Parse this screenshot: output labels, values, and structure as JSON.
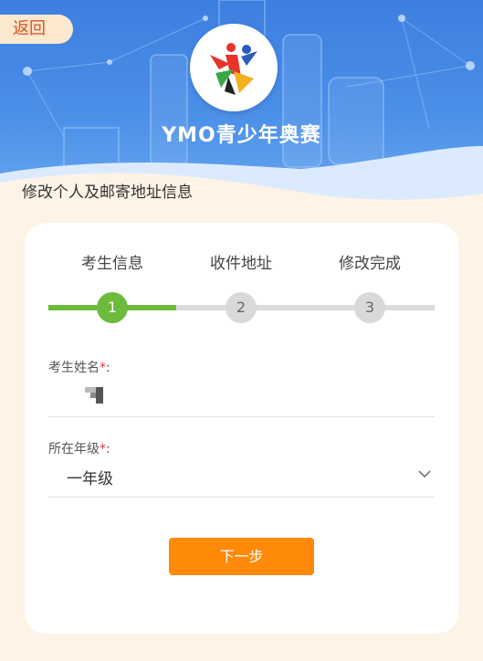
{
  "header": {
    "back_label": "返回",
    "brand": "YMO青少年奥赛",
    "logo_icon": "ymo-logo-icon"
  },
  "page": {
    "subtitle": "修改个人及邮寄地址信息"
  },
  "steps": {
    "labels": [
      "考生信息",
      "收件地址",
      "修改完成"
    ],
    "numbers": [
      "1",
      "2",
      "3"
    ],
    "current": 1,
    "progress_fraction": 0.33
  },
  "form": {
    "name_label": "考生姓名",
    "name_required": "*",
    "name_colon": ":",
    "grade_label": "所在年级",
    "grade_required": "*",
    "grade_colon": ":",
    "grade_value": "一年级"
  },
  "actions": {
    "next_label": "下一步"
  },
  "colors": {
    "header_blue": "#3d7fe0",
    "accent_green": "#6cbb3c",
    "button_orange": "#ff8a0a",
    "back_text": "#d9531e",
    "required_red": "#e03a3a"
  }
}
